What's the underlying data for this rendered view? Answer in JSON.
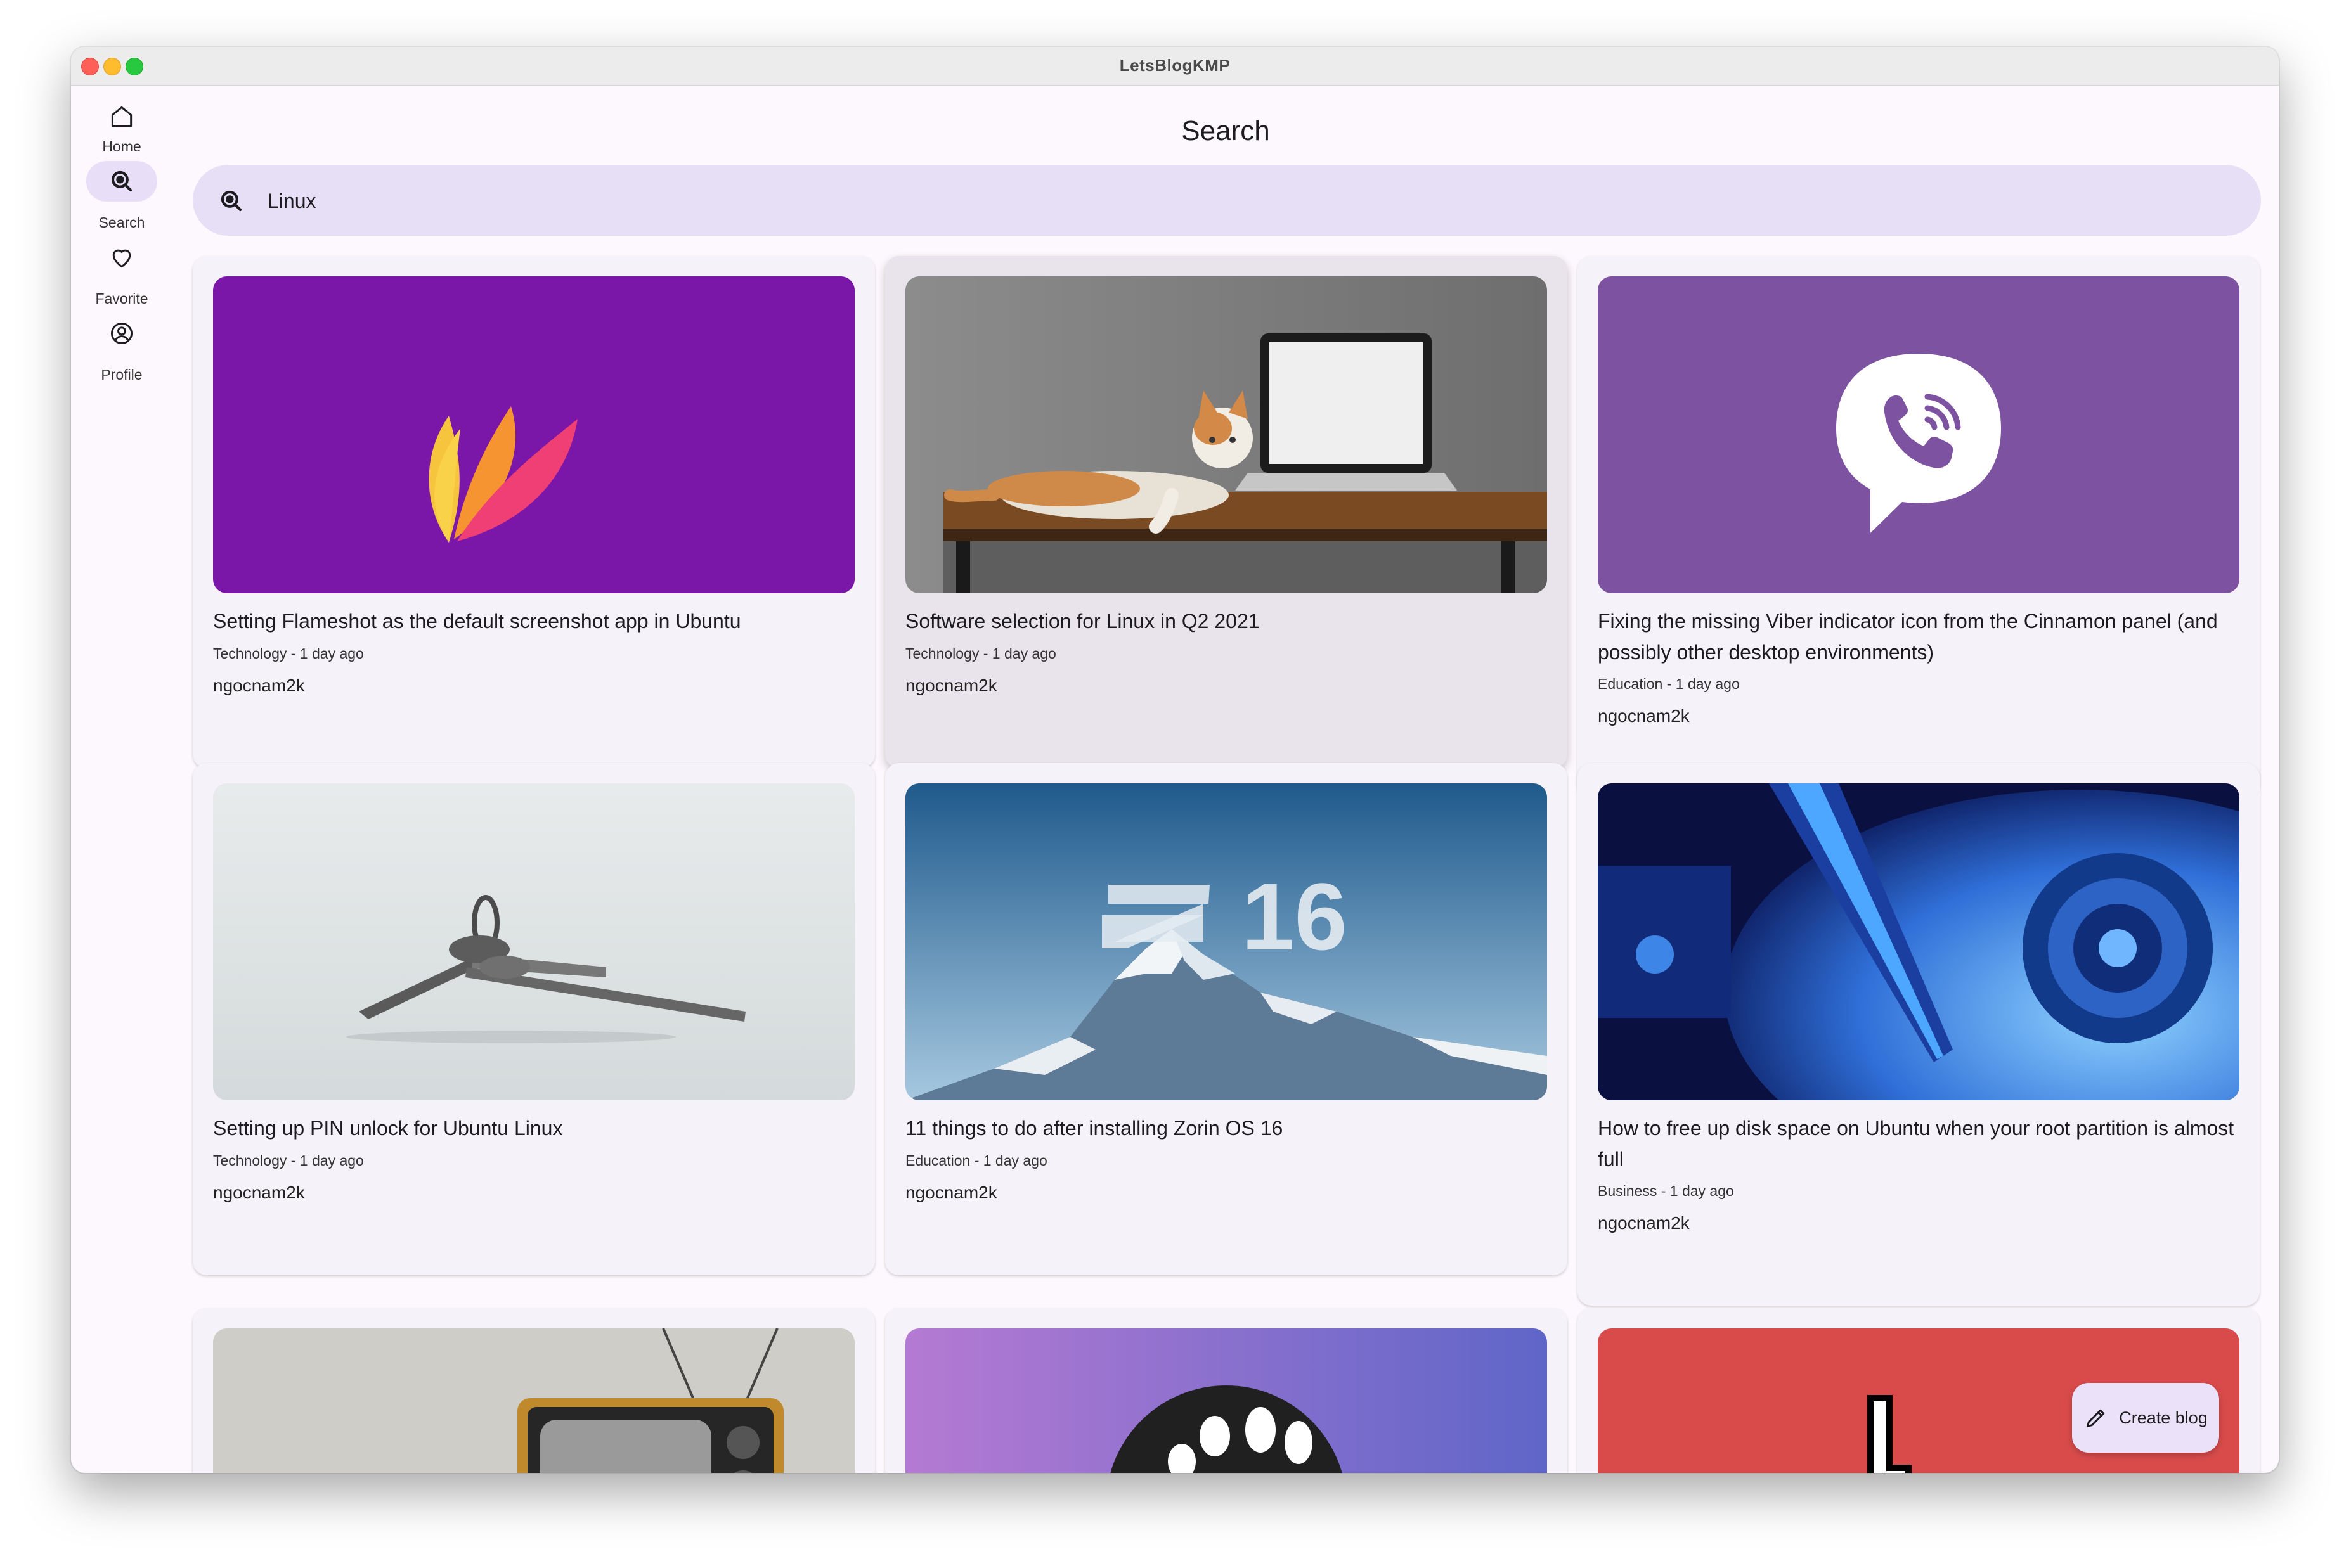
{
  "window": {
    "title": "LetsBlogKMP"
  },
  "nav": {
    "items": [
      {
        "label": "Home",
        "icon": "home-icon"
      },
      {
        "label": "Search",
        "icon": "search-icon",
        "active": true
      },
      {
        "label": "Favorite",
        "icon": "heart-icon"
      },
      {
        "label": "Profile",
        "icon": "profile-icon"
      }
    ]
  },
  "page": {
    "title": "Search"
  },
  "search": {
    "value": "Linux"
  },
  "posts": [
    {
      "title": "Setting Flameshot as the default screenshot app in Ubuntu",
      "meta": "Technology - 1 day ago",
      "author": "ngocnam2k"
    },
    {
      "title": "Software selection for Linux in Q2 2021",
      "meta": "Technology - 1 day ago",
      "author": "ngocnam2k"
    },
    {
      "title": "Fixing the missing Viber indicator icon from the Cinnamon panel (and possibly other desktop environments)",
      "meta": "Education - 1 day ago",
      "author": "ngocnam2k"
    },
    {
      "title": "Setting up PIN unlock for Ubuntu Linux",
      "meta": "Technology - 1 day ago",
      "author": "ngocnam2k"
    },
    {
      "title": "11 things to do after installing Zorin OS 16",
      "meta": "Education - 1 day ago",
      "author": "ngocnam2k"
    },
    {
      "title": "How to free up disk space on Ubuntu when your root partition is almost full",
      "meta": "Business - 1 day ago",
      "author": "ngocnam2k"
    }
  ],
  "images": {
    "zorin_logo": "16"
  },
  "fab": {
    "label": "Create blog",
    "icon": "pencil-icon"
  },
  "colors": {
    "accent": "#e9def8",
    "search_bg": "#e7dff5",
    "card_bg": "#f6f2f9",
    "background": "#fdf8fd"
  }
}
